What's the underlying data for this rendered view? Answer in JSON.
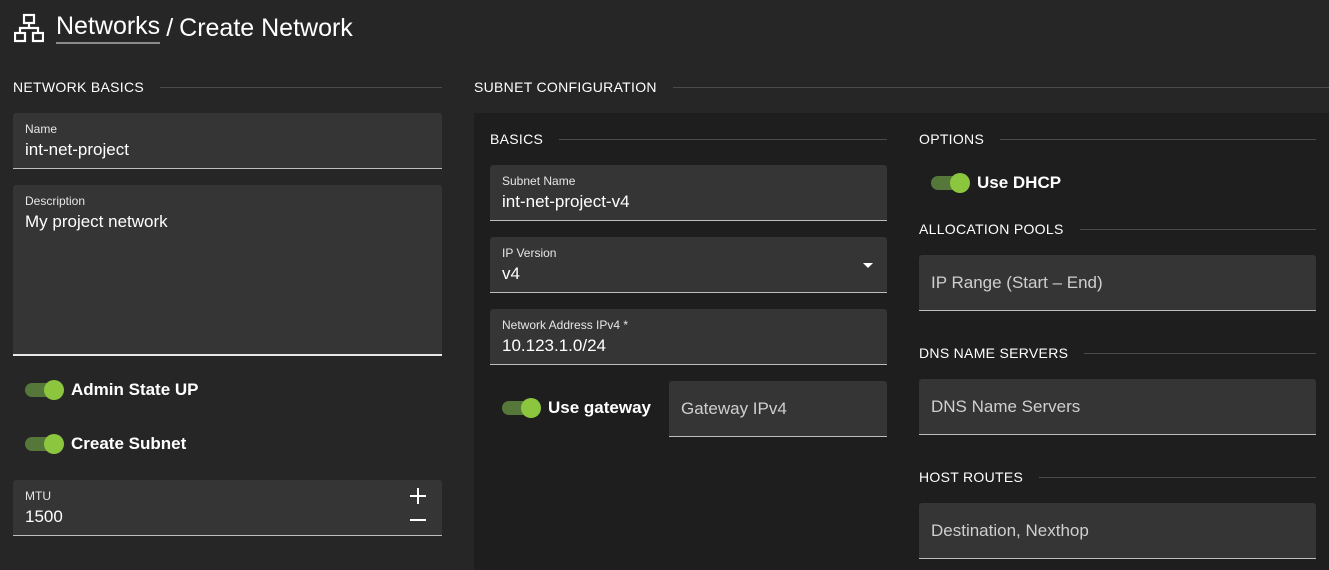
{
  "header": {
    "link": "Networks",
    "separator": "/",
    "title": "Create Network",
    "icon": "network-icon"
  },
  "basics_section": {
    "title": "NETWORK BASICS",
    "name": {
      "label": "Name",
      "value": "int-net-project"
    },
    "description": {
      "label": "Description",
      "value": "My project network"
    },
    "admin_state": {
      "label": "Admin State UP",
      "on": true
    },
    "create_subnet": {
      "label": "Create Subnet",
      "on": true
    },
    "mtu": {
      "label": "MTU",
      "value": "1500"
    }
  },
  "subnet_section": {
    "title": "SUBNET CONFIGURATION",
    "basics_title": "BASICS",
    "subnet_name": {
      "label": "Subnet Name",
      "value": "int-net-project-v4"
    },
    "ip_version": {
      "label": "IP Version",
      "value": "v4"
    },
    "network_address": {
      "label": "Network Address IPv4 *",
      "value": "10.123.1.0/24"
    },
    "use_gateway": {
      "label": "Use gateway",
      "on": true
    },
    "gateway": {
      "placeholder": "Gateway IPv4"
    },
    "options_title": "OPTIONS",
    "use_dhcp": {
      "label": "Use DHCP",
      "on": true
    },
    "allocation_title": "ALLOCATION POOLS",
    "allocation": {
      "placeholder": "IP Range (Start – End)"
    },
    "dns_title": "DNS NAME SERVERS",
    "dns": {
      "placeholder": "DNS Name Servers"
    },
    "routes_title": "HOST ROUTES",
    "routes": {
      "placeholder": "Destination, Nexthop"
    }
  },
  "colors": {
    "accent": "#8cc63f",
    "track": "#55783a",
    "background": "#262626",
    "panel": "#1e1e1e",
    "field": "#353535"
  }
}
